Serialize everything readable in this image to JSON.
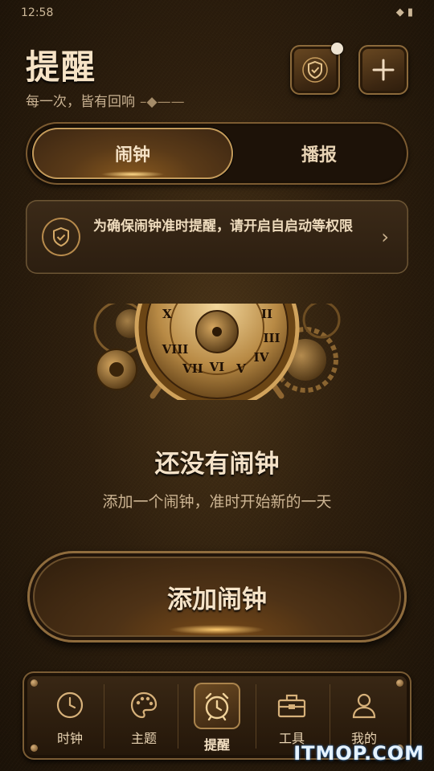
{
  "status_bar": {
    "time": "12:58",
    "icons": "◆ ▮"
  },
  "header": {
    "title": "提醒",
    "subtitle": "每一次，皆有回响",
    "subtitle_ornament": "–◆——",
    "shield_icon": "shield-check-icon",
    "add_label": "+"
  },
  "tabs": [
    {
      "label": "闹钟",
      "active": true
    },
    {
      "label": "播报",
      "active": false
    }
  ],
  "notice": {
    "text": "为确保闹钟准时提醒，请开启自启动等权限",
    "chevron": "›"
  },
  "empty_state": {
    "title": "还没有闹钟",
    "subtitle": "添加一个闹钟，准时开始新的一天"
  },
  "primary_button": {
    "label": "添加闹钟"
  },
  "bottom_nav": [
    {
      "label": "时钟",
      "icon": "clock-icon",
      "active": false
    },
    {
      "label": "主题",
      "icon": "palette-icon",
      "active": false
    },
    {
      "label": "提醒",
      "icon": "alarm-clock-icon",
      "active": true
    },
    {
      "label": "工具",
      "icon": "toolbox-icon",
      "active": false
    },
    {
      "label": "我的",
      "icon": "user-icon",
      "active": false
    }
  ],
  "watermark": "ITMOP.COM",
  "colors": {
    "accent": "#c39a5a",
    "text": "#f1dcc0",
    "background": "#2e1f0e"
  }
}
